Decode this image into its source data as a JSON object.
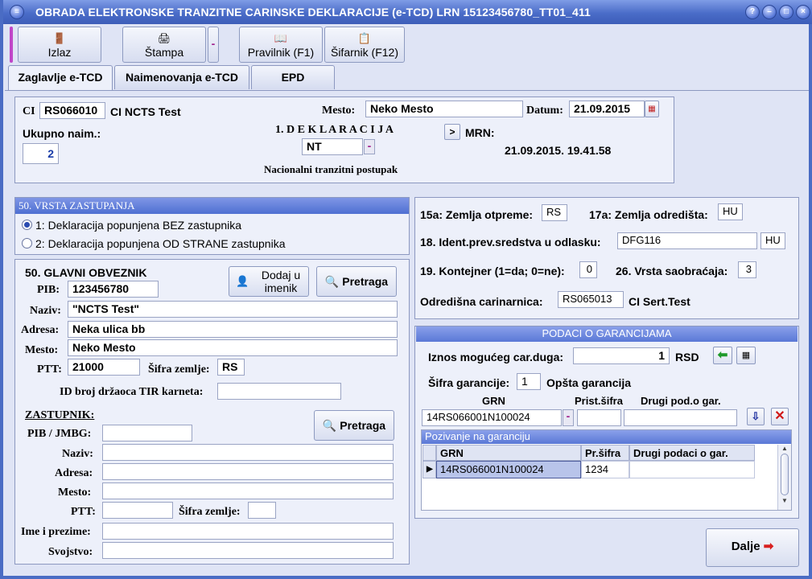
{
  "window": {
    "title": "OBRADA ELEKTRONSKE TRANZITNE CARINSKE DEKLARACIJE (e-TCD)  LRN 15123456780_TT01_411"
  },
  "toolbar": {
    "izlaz": "Izlaz",
    "stampa": "Štampa",
    "pravilnik": "Pravilnik (F1)",
    "sifarnik": "Šifarnik (F12)"
  },
  "tabs": [
    "Zaglavlje e-TCD",
    "Naimenovanja e-TCD",
    "EPD"
  ],
  "header": {
    "ci_label": "CI",
    "ci_value": "RS066010",
    "ci_name": "CI NCTS Test",
    "mesto_label": "Mesto:",
    "mesto_value": "Neko Mesto",
    "datum_label": "Datum:",
    "datum_value": "21.09.2015",
    "ukupno_label": "Ukupno naim.:",
    "ukupno_value": "2",
    "deklaracija": "1.  D E K L A R A C I J A",
    "decl_type": "NT",
    "postupak": "Nacionalni tranzitni postupak",
    "mrn_btn": ">",
    "mrn_label": "MRN:",
    "timestamp": "21.09.2015. 19.41.58"
  },
  "zastupanje": {
    "title": "50. VRSTA ZASTUPANJA",
    "opt1": "1: Deklaracija popunjena BEZ zastupnika",
    "opt2": "2: Deklaracija popunjena OD STRANE zastupnika"
  },
  "obveznik": {
    "title": "50. GLAVNI OBVEZNIK",
    "dodaj": "Dodaj u imenik",
    "pretraga": "Pretraga",
    "pib_label": "PIB:",
    "pib": "123456780",
    "naziv_label": "Naziv:",
    "naziv": "\"NCTS Test\"",
    "adresa_label": "Adresa:",
    "adresa": "Neka ulica bb",
    "mesto_label": "Mesto:",
    "mesto": "Neko Mesto",
    "ptt_label": "PTT:",
    "ptt": "21000",
    "sifra_label": "Šifra zemlje:",
    "sifra": "RS",
    "tir_label": "ID broj držaoca TIR karneta:"
  },
  "zastupnik": {
    "title": "ZASTUPNIK:",
    "pretraga": "Pretraga",
    "pib_label": "PIB / JMBG:",
    "naziv_label": "Naziv:",
    "adresa_label": "Adresa:",
    "mesto_label": "Mesto:",
    "ptt_label": "PTT:",
    "sifra_label": "Šifra zemlje:",
    "ime_label": "Ime i prezime:",
    "svojstvo_label": "Svojstvo:"
  },
  "transport": {
    "otprema_label": "15a: Zemlja otpreme:",
    "otprema": "RS",
    "odrediste_label": "17a: Zemlja odredišta:",
    "odrediste": "HU",
    "ident_label": "18. Ident.prev.sredstva u odlasku:",
    "ident": "DFG116",
    "ident_country": "HU",
    "kontejner_label": "19. Kontejner (1=da; 0=ne):",
    "kontejner": "0",
    "vrsta_label": "26. Vrsta saobraćaja:",
    "vrsta": "3",
    "carinarnica_label": "Odredišna carinarnica:",
    "carinarnica": "RS065013",
    "carinarnica_name": "CI Sert.Test"
  },
  "garancije": {
    "title": "PODACI O GARANCIJAMA",
    "iznos_label": "Iznos mogućeg car.duga:",
    "iznos": "1",
    "valuta": "RSD",
    "sifra_label": "Šifra garancije:",
    "sifra": "1",
    "sifra_name": "Opšta garancija",
    "grn_label": "GRN",
    "prist_label": "Prist.šifra",
    "drugi_label": "Drugi pod.o gar.",
    "grn_value": "14RS066001N100024",
    "grid_title": "Pozivanje na garanciju",
    "col_grn": "GRN",
    "col_pr": "Pr.šifra",
    "col_drugi": "Drugi podaci o gar.",
    "row_grn": "14RS066001N100024",
    "row_pr": "1234"
  },
  "dalje": "Dalje"
}
